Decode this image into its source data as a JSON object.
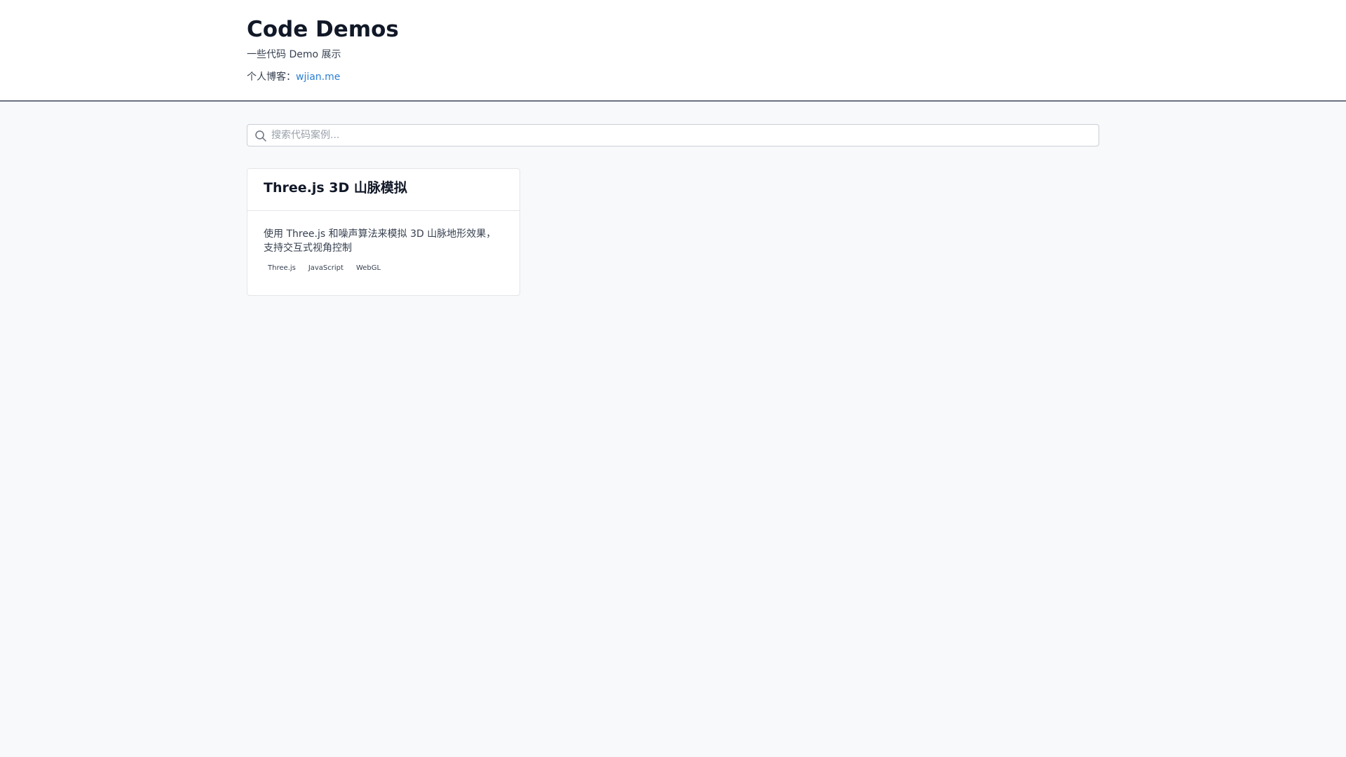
{
  "header": {
    "title": "Code Demos",
    "subtitle": "一些代码 Demo 展示",
    "blog_prefix": "个人博客：",
    "blog_link": "wjian.me"
  },
  "search": {
    "placeholder": "搜索代码案例...",
    "value": ""
  },
  "cards": [
    {
      "title": "Three.js 3D 山脉模拟",
      "description": "使用 Three.js 和噪声算法来模拟 3D 山脉地形效果，支持交互式视角控制",
      "tags": [
        "Three.js",
        "JavaScript",
        "WebGL"
      ]
    }
  ],
  "colors": {
    "link": "#2b7fd4",
    "background": "#f8f9fb",
    "header_border": "#6b7280"
  },
  "icons": {
    "search": "search-icon"
  }
}
